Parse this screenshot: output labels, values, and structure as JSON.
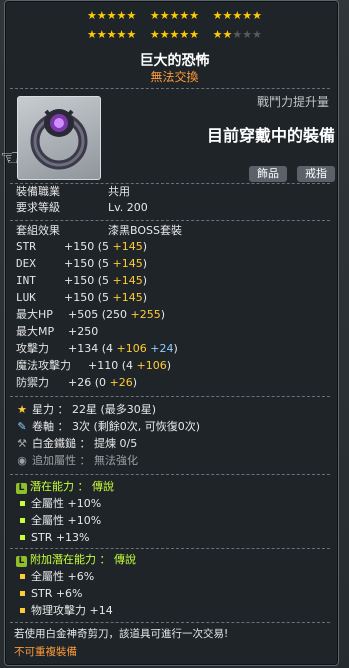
{
  "stars": {
    "row1": [
      "★★★★★",
      "★★★★★",
      "★★★★★"
    ],
    "row2_on": [
      "★★★★★",
      "★★★★★",
      "★★"
    ],
    "row2_off": [
      "",
      "",
      "★★★"
    ]
  },
  "item": {
    "name": "巨大的恐怖",
    "trade": "無法交換",
    "power_label": "戰鬥力提升量",
    "equip_status": "目前穿戴中的裝備",
    "tags": [
      "飾品",
      "戒指"
    ]
  },
  "base": {
    "job_label": "裝備職業",
    "job_value": "共用",
    "level_label": "要求等級",
    "level_value": "Lv. 200"
  },
  "set": {
    "label": "套組效果",
    "value": "漆黑BOSS套裝"
  },
  "stats": [
    {
      "label": "STR",
      "total": "+150",
      "open": " (5 ",
      "plus": "+145",
      "close": ")"
    },
    {
      "label": "DEX",
      "total": "+150",
      "open": " (5 ",
      "plus": "+145",
      "close": ")"
    },
    {
      "label": "INT",
      "total": "+150",
      "open": " (5 ",
      "plus": "+145",
      "close": ")"
    },
    {
      "label": "LUK",
      "total": "+150",
      "open": " (5 ",
      "plus": "+145",
      "close": ")"
    },
    {
      "label": "最大HP",
      "total": "+505",
      "open": " (250 ",
      "plus": "+255",
      "close": ")"
    },
    {
      "label": "最大MP",
      "total": "+250",
      "open": "",
      "plus": "",
      "close": ""
    },
    {
      "label": "攻擊力",
      "total": "+134",
      "open": " (4 ",
      "plus": "+106",
      "extra": " +24",
      "close": ")"
    },
    {
      "label": "魔法攻擊力",
      "total": "+110",
      "open": " (4 ",
      "plus": "+106",
      "close": ")"
    },
    {
      "label": "防禦力",
      "total": "+26",
      "open": " (0 ",
      "plus": "+26",
      "close": ")"
    }
  ],
  "upgrade": {
    "stars_label": "星力 ： 22星 (最多30星)",
    "scroll_label": "卷軸 ： 3次 (剩餘0次, 可恢復0次)",
    "hammer_label": "白金鐵鎚 ： 提煉 0/5",
    "extra_label": "追加屬性 ： 無法強化"
  },
  "potential": {
    "title": "潛在能力 ： 傳說",
    "lines": [
      "全屬性 +10%",
      "全屬性 +10%",
      "STR +13%"
    ]
  },
  "bonus_potential": {
    "title": "附加潛在能力 ： 傳說",
    "lines": [
      "全屬性 +6%",
      "STR +6%",
      "物理攻擊力 +14"
    ]
  },
  "footer": {
    "note": "若使用白金神奇剪刀，該道具可進行一次交易!",
    "warning": "不可重複裝備"
  }
}
